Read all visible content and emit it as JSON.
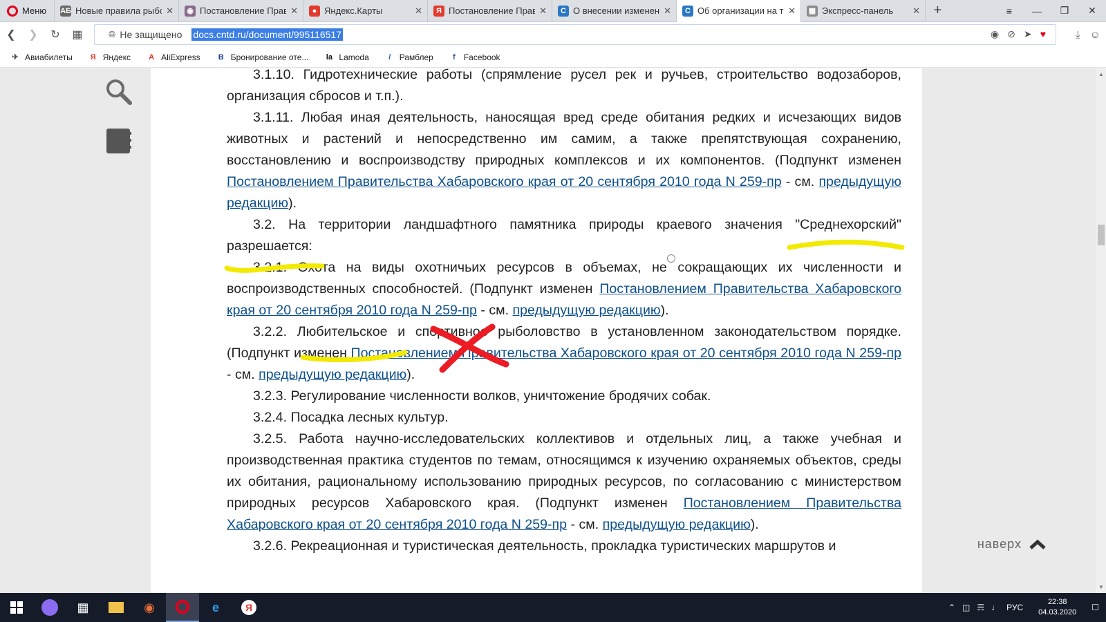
{
  "browser": {
    "menu_label": "Меню",
    "tabs": [
      {
        "label": "Новые правила рыболо",
        "icon": "news-favicon-icon",
        "glyph": "АБ",
        "color": "#6a6a6a"
      },
      {
        "label": "Постановление Правит",
        "icon": "emblem-favicon-icon",
        "glyph": "◉",
        "color": "#8a6a8a"
      },
      {
        "label": "Яндекс.Карты",
        "icon": "map-pin-favicon-icon",
        "glyph": "●",
        "color": "#e23b2e"
      },
      {
        "label": "Постановление Правит",
        "icon": "yandex-favicon-icon",
        "glyph": "Я",
        "color": "#e23b2e"
      },
      {
        "label": "О внесении изменений",
        "icon": "cntd-favicon-icon",
        "glyph": "C",
        "color": "#2a78c4"
      },
      {
        "label": "Об организации на тер",
        "icon": "cntd-favicon-icon",
        "glyph": "C",
        "color": "#2a78c4"
      },
      {
        "label": "Экспресс-панель",
        "icon": "grid-favicon-icon",
        "glyph": "▦",
        "color": "#8a8a8a"
      }
    ],
    "new_tab": "+",
    "address": {
      "security": "Не защищено",
      "url": "docs.cntd.ru/document/995116517"
    },
    "bookmarks": [
      {
        "label": "Авиабилеты",
        "icon": "plane-icon",
        "glyph": "✈",
        "color": "#444"
      },
      {
        "label": "Яндекс",
        "icon": "yandex-icon",
        "glyph": "Я",
        "color": "#e23b2e"
      },
      {
        "label": "AliExpress",
        "icon": "aliexpress-icon",
        "glyph": "A",
        "color": "#e43225"
      },
      {
        "label": "Бронирование оте...",
        "icon": "booking-icon",
        "glyph": "B",
        "color": "#1d3f8a"
      },
      {
        "label": "Lamoda",
        "icon": "lamoda-icon",
        "glyph": "la",
        "color": "#111"
      },
      {
        "label": "Рамблер",
        "icon": "rambler-icon",
        "glyph": "/",
        "color": "#2a56c6"
      },
      {
        "label": "Facebook",
        "icon": "facebook-icon",
        "glyph": "f",
        "color": "#3b5998"
      }
    ]
  },
  "document": {
    "paragraphs": [
      {
        "parts": [
          {
            "t": "3.1.10. Гидротехнические работы (спрямление русел рек и ручьев, строительство водозаборов, организация сбросов и т.п.)."
          }
        ]
      },
      {
        "parts": [
          {
            "t": "3.1.11. Любая иная деятельность, наносящая вред среде обитания редких и исчезающих видов животных и растений и непосредственно им самим, а также препятствующая сохранению, восстановлению и воспроизводству природных комплексов и их компонентов. (Подпункт изменен "
          },
          {
            "t": "Постановлением Правительства Хабаровского края от 20 сентября 2010 года N 259-пр",
            "link": true
          },
          {
            "t": " - см. "
          },
          {
            "t": "предыдущую редакцию",
            "link": true
          },
          {
            "t": ")."
          }
        ]
      },
      {
        "parts": [
          {
            "t": "3.2. На территории ландшафтного памятника природы краевого значения \"Среднехорский\" разрешается:"
          }
        ]
      },
      {
        "parts": [
          {
            "t": "3.2.1. Охота на виды охотничьих ресурсов в объемах, не сокращающих их численности и воспроизводственных способностей. (Подпункт изменен "
          },
          {
            "t": "Постановлением Правительства Хабаровского края от 20 сентября 2010 года N 259-пр",
            "link": true
          },
          {
            "t": " - см. "
          },
          {
            "t": "предыдущую редакцию",
            "link": true
          },
          {
            "t": ")."
          }
        ]
      },
      {
        "parts": [
          {
            "t": "3.2.2. Любительское и спортивное рыболовство в установленном законодательством порядке. (Подпункт изменен "
          },
          {
            "t": "Постановлением Правительства Хабаровского края от 20 сентября 2010 года N 259-пр",
            "link": true
          },
          {
            "t": " - см. "
          },
          {
            "t": "предыдущую редакцию",
            "link": true
          },
          {
            "t": ")."
          }
        ]
      },
      {
        "parts": [
          {
            "t": "3.2.3. Регулирование численности волков, уничтожение бродячих собак."
          }
        ]
      },
      {
        "parts": [
          {
            "t": "3.2.4. Посадка лесных культур."
          }
        ]
      },
      {
        "parts": [
          {
            "t": "3.2.5. Работа научно-исследовательских коллективов и отдельных лиц, а также учебная и производственная практика студентов по темам, относящимся к изучению охраняемых объектов, среды их обитания, рациональному использованию природных ресурсов, по согласованию с министерством природных ресурсов Хабаровского края. (Подпункт изменен "
          },
          {
            "t": "Постановлением Правительства Хабаровского края от 20 сентября 2010 года N 259-пр",
            "link": true
          },
          {
            "t": " - см. "
          },
          {
            "t": "предыдущую редакцию",
            "link": true
          },
          {
            "t": ")."
          }
        ]
      },
      {
        "parts": [
          {
            "t": "3.2.6. Рекреационная и туристическая деятельность, прокладка туристических маршрутов и"
          }
        ]
      }
    ],
    "to_top_label": "наверх"
  },
  "colors": {
    "highlighter": "#f2ea00",
    "cross": "#ec1c24",
    "link": "#0d4f8b"
  },
  "taskbar": {
    "language": "РУС",
    "time": "22:38",
    "date": "04.03.2020"
  }
}
